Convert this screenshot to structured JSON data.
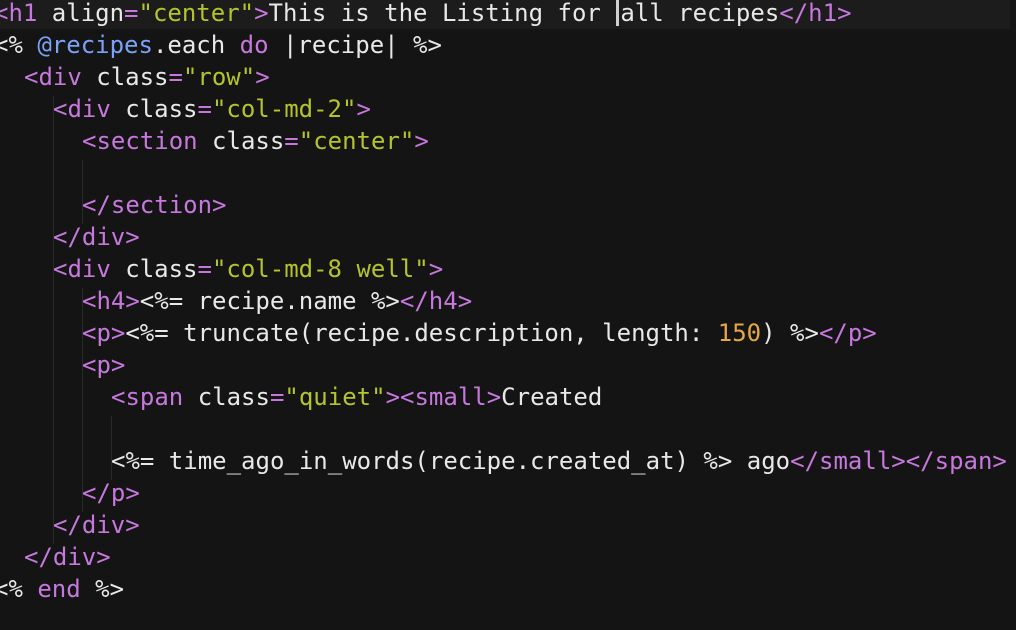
{
  "editor": {
    "language": "erb",
    "background": "#141414",
    "colors": {
      "tag": "#c678dd",
      "string": "#b5c32e",
      "instance_variable": "#7aa2f7",
      "number": "#e5a645",
      "text": "#e8e8e8"
    },
    "lines": [
      {
        "l1_t1": "<h1 ",
        "l1_t2": "align",
        "l1_t3": "=",
        "l1_t4": "\"center\"",
        "l1_t5": ">",
        "l1_t6": "This is the Listing for ",
        "l1_t7": "all recipes",
        "l1_t8": "</h1>"
      },
      {
        "l2_t1": "<% ",
        "l2_t2": "@recipes",
        "l2_t3": ".each ",
        "l2_t4": "do",
        "l2_t5": " |recipe| %>"
      },
      {
        "l3_t1": "<div ",
        "l3_t2": "class",
        "l3_t3": "=",
        "l3_t4": "\"row\"",
        "l3_t5": ">"
      },
      {
        "l4_t1": "<div ",
        "l4_t2": "class",
        "l4_t3": "=",
        "l4_t4": "\"col-md-2\"",
        "l4_t5": ">"
      },
      {
        "l5_t1": "<section ",
        "l5_t2": "class",
        "l5_t3": "=",
        "l5_t4": "\"center\"",
        "l5_t5": ">"
      },
      {
        "l6_t1": ""
      },
      {
        "l7_t1": "</section>"
      },
      {
        "l8_t1": "</div>"
      },
      {
        "l9_t1": "<div ",
        "l9_t2": "class",
        "l9_t3": "=",
        "l9_t4": "\"col-md-8 well\"",
        "l9_t5": ">"
      },
      {
        "l10_t1": "<h4>",
        "l10_t2": "<%= recipe.name %>",
        "l10_t3": "</h4>"
      },
      {
        "l11_t1": "<p>",
        "l11_t2": "<%= truncate(recipe.description, length: ",
        "l11_t3": "150",
        "l11_t4": ") %>",
        "l11_t5": "</p>"
      },
      {
        "l12_t1": "<p>"
      },
      {
        "l13_t1": "<span ",
        "l13_t2": "class",
        "l13_t3": "=",
        "l13_t4": "\"quiet\"",
        "l13_t5": ">",
        "l13_t6": "<small>",
        "l13_t7": "Created"
      },
      {
        "l14_t1": ""
      },
      {
        "l15_t1": "<%= time_ago_in_words(recipe.created_at) %> ago",
        "l15_t2": "</small>",
        "l15_t3": "</span>"
      },
      {
        "l16_t1": "</p>"
      },
      {
        "l17_t1": "</div>"
      },
      {
        "l18_t1": "</div>"
      },
      {
        "l19_t1": "<% ",
        "l19_t2": "end",
        "l19_t3": " %>"
      }
    ]
  }
}
